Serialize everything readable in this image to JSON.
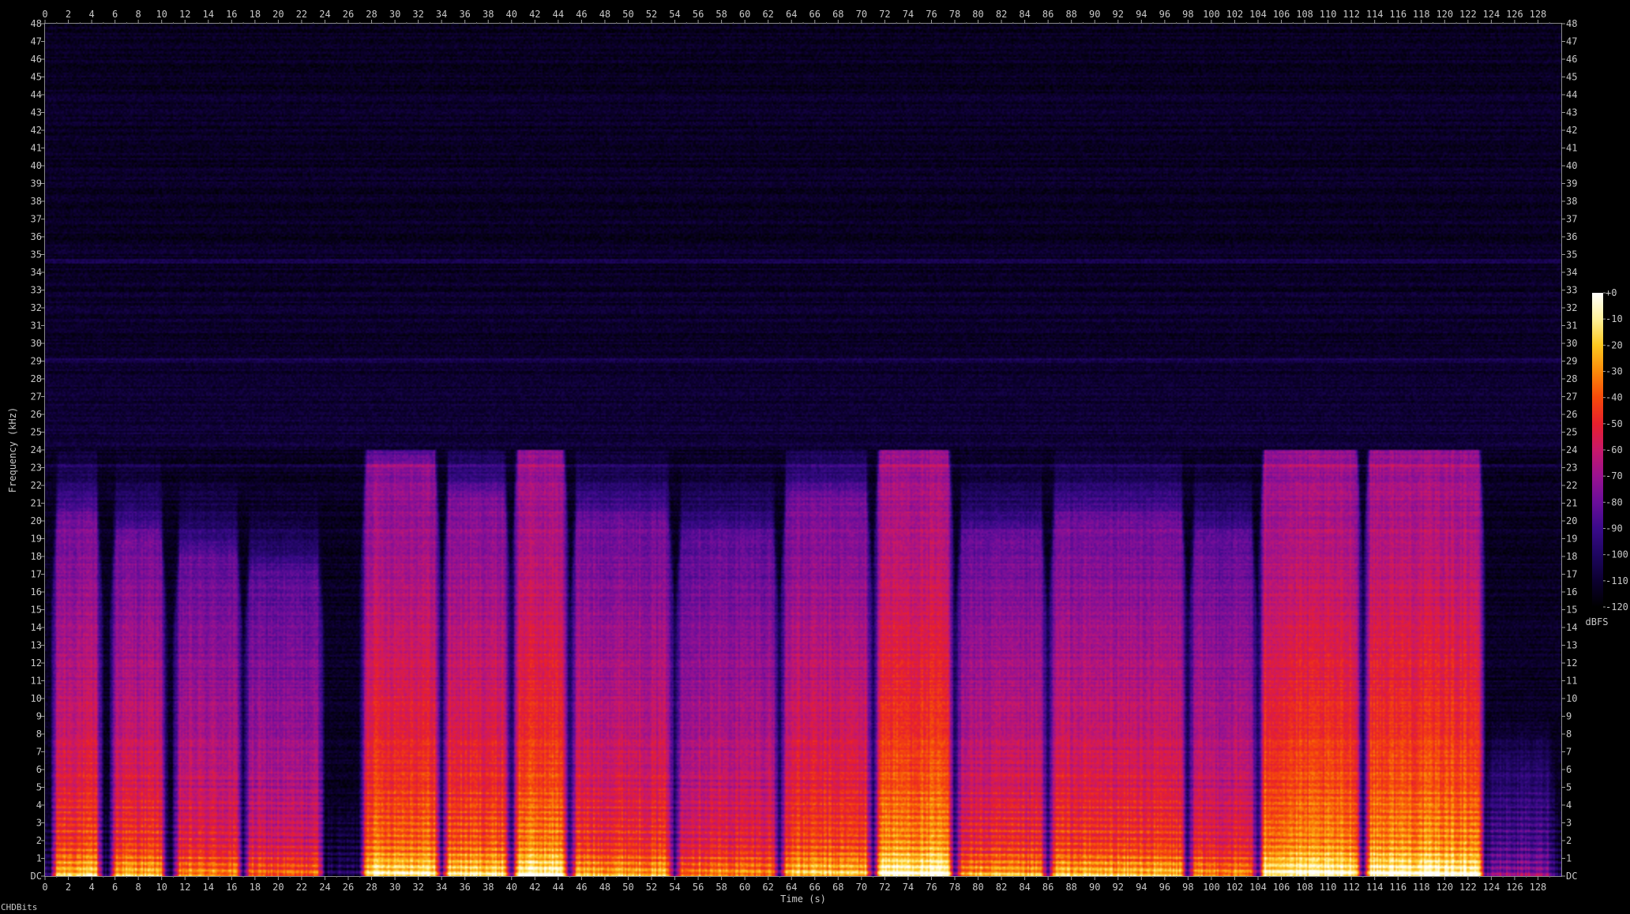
{
  "chart_data": {
    "type": "heatmap",
    "xlabel": "Time (s)",
    "ylabel": "Frequency (kHz)",
    "xlim": [
      0,
      130
    ],
    "ylim": [
      0,
      48
    ],
    "x_ticks": [
      0,
      2,
      4,
      6,
      8,
      10,
      12,
      14,
      16,
      18,
      20,
      22,
      24,
      26,
      28,
      30,
      32,
      34,
      36,
      38,
      40,
      42,
      44,
      46,
      48,
      50,
      52,
      54,
      56,
      58,
      60,
      62,
      64,
      66,
      68,
      70,
      72,
      74,
      76,
      78,
      80,
      82,
      84,
      86,
      88,
      90,
      92,
      94,
      96,
      98,
      100,
      102,
      104,
      106,
      108,
      110,
      112,
      114,
      116,
      118,
      120,
      122,
      124,
      126,
      128
    ],
    "y_ticks": [
      "DC",
      "1",
      "2",
      "3",
      "4",
      "5",
      "6",
      "7",
      "8",
      "9",
      "10",
      "11",
      "12",
      "13",
      "14",
      "15",
      "16",
      "17",
      "18",
      "19",
      "20",
      "21",
      "22",
      "23",
      "24",
      "25",
      "26",
      "27",
      "28",
      "29",
      "30",
      "31",
      "32",
      "33",
      "34",
      "35",
      "36",
      "37",
      "38",
      "39",
      "40",
      "41",
      "42",
      "43",
      "44",
      "45",
      "46",
      "47",
      "48"
    ],
    "colorbar": {
      "label": "dBFS",
      "ticks": [
        "+0",
        "-10",
        "-20",
        "-30",
        "-40",
        "-50",
        "-60",
        "-70",
        "-80",
        "-90",
        "-100",
        "-110",
        "-120"
      ],
      "range": [
        -120,
        0
      ],
      "colors": [
        "#000000",
        "#0c0030",
        "#1e0660",
        "#3a0a8a",
        "#6a0e9a",
        "#9a1290",
        "#c8186a",
        "#e8202c",
        "#f64a0a",
        "#fb8a0a",
        "#fdc820",
        "#fff29a",
        "#ffffff"
      ]
    },
    "dominant_band_khz": [
      0,
      24
    ],
    "noise_lines_khz": [
      34.6,
      29.0,
      23.1
    ],
    "segments": [
      {
        "start": 0.5,
        "end": 5,
        "level": 0.68,
        "top_khz": 20
      },
      {
        "start": 5.5,
        "end": 10.5,
        "level": 0.66,
        "top_khz": 19
      },
      {
        "start": 11,
        "end": 17,
        "level": 0.6,
        "top_khz": 18
      },
      {
        "start": 17,
        "end": 24,
        "level": 0.55,
        "top_khz": 17
      },
      {
        "start": 27,
        "end": 34,
        "level": 0.75,
        "top_khz": 23
      },
      {
        "start": 34,
        "end": 40,
        "level": 0.72,
        "top_khz": 21
      },
      {
        "start": 40,
        "end": 45,
        "level": 0.78,
        "top_khz": 24
      },
      {
        "start": 45,
        "end": 54,
        "level": 0.65,
        "top_khz": 20
      },
      {
        "start": 54,
        "end": 63,
        "level": 0.6,
        "top_khz": 19
      },
      {
        "start": 63,
        "end": 71,
        "level": 0.68,
        "top_khz": 21
      },
      {
        "start": 71,
        "end": 78,
        "level": 0.8,
        "top_khz": 24
      },
      {
        "start": 78,
        "end": 86,
        "level": 0.62,
        "top_khz": 19
      },
      {
        "start": 86,
        "end": 98,
        "level": 0.66,
        "top_khz": 20
      },
      {
        "start": 98,
        "end": 104,
        "level": 0.6,
        "top_khz": 19
      },
      {
        "start": 104,
        "end": 113,
        "level": 0.78,
        "top_khz": 24
      },
      {
        "start": 113,
        "end": 123.5,
        "level": 0.8,
        "top_khz": 24
      },
      {
        "start": 123.5,
        "end": 129.5,
        "level": 0.3,
        "top_khz": 6
      }
    ]
  },
  "footer": {
    "label": "CHDBits"
  }
}
